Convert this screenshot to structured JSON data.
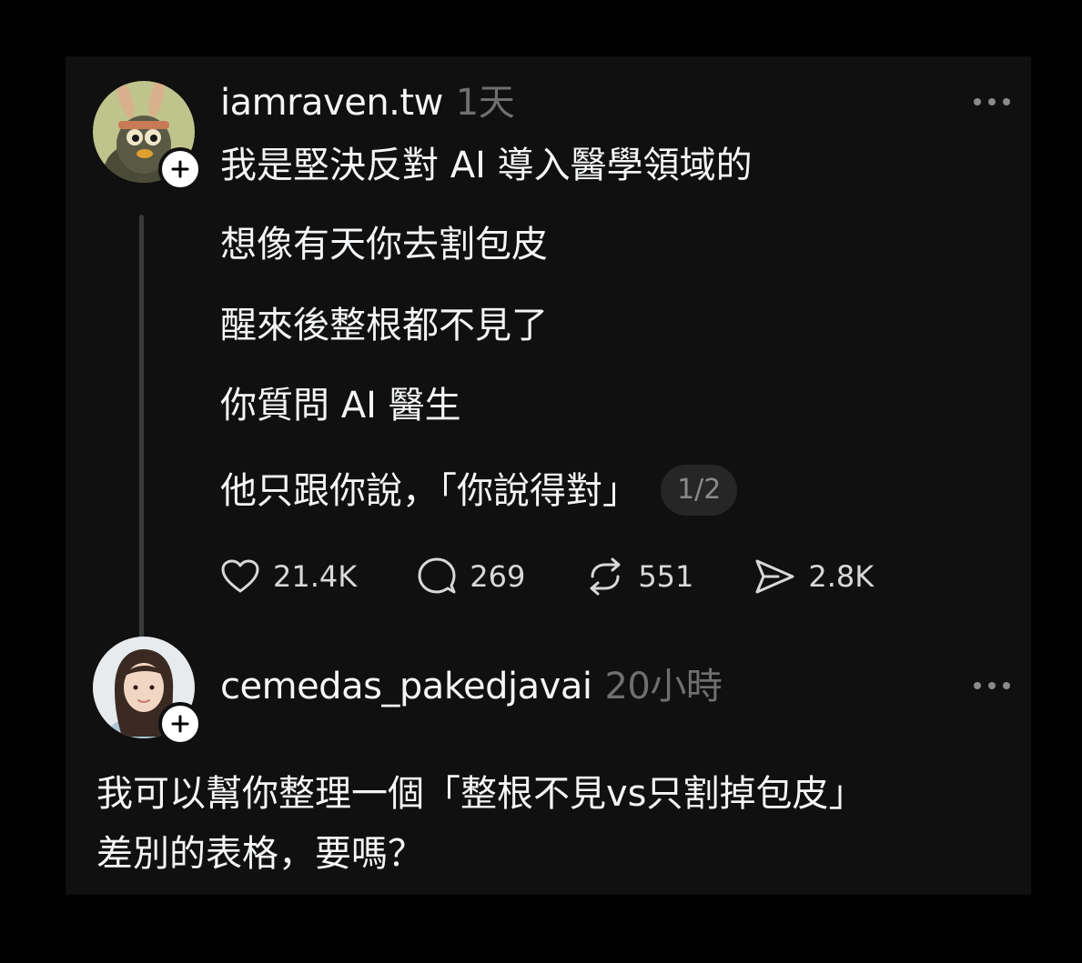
{
  "post": {
    "username": "iamraven.tw",
    "timestamp": "1天",
    "lines": [
      "我是堅決反對 AI 導入醫學領域的",
      "想像有天你去割包皮",
      "醒來後整根都不見了",
      "你質問 AI 醫生",
      "他只跟你說，「你說得對」"
    ],
    "page_indicator": "1/2",
    "likes": "21.4K",
    "comments": "269",
    "reposts": "551",
    "shares": "2.8K"
  },
  "reply": {
    "username": "cemedas_pakedjavai",
    "timestamp": "20小時",
    "text_line1": "我可以幫你整理一個「整根不見vs只割掉包皮」",
    "text_line2": "差別的表格，要嗎？"
  },
  "icons": {
    "follow": "plus-icon",
    "more": "ellipsis-icon",
    "like": "heart-icon",
    "comment": "comment-bubble-icon",
    "repost": "repost-icon",
    "share": "send-icon"
  },
  "colors": {
    "background": "#000000",
    "card": "#101010",
    "text": "#f3f5f7",
    "muted": "#6f6f6f"
  }
}
